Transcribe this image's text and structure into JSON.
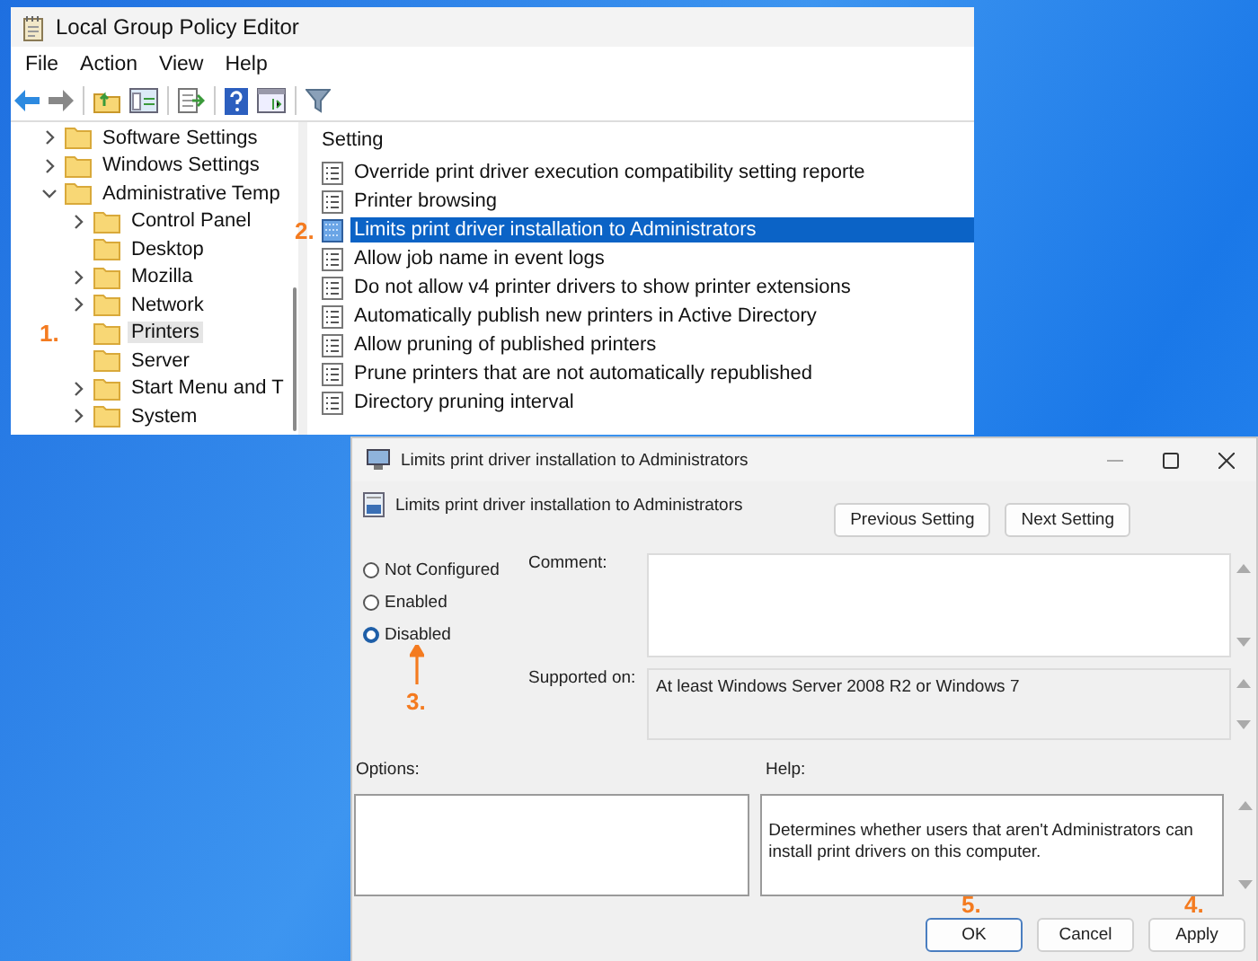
{
  "editor": {
    "title": "Local Group Policy Editor",
    "menu": [
      "File",
      "Action",
      "View",
      "Help"
    ],
    "tree": [
      {
        "label": "Software Settings",
        "expanded": false,
        "selected": false
      },
      {
        "label": "Windows Settings",
        "expanded": false,
        "selected": false
      },
      {
        "label": "Administrative Temp",
        "expanded": true,
        "selected": false,
        "children": [
          {
            "label": "Control Panel",
            "expanded": false,
            "selected": false
          },
          {
            "label": "Desktop",
            "selected": false
          },
          {
            "label": "Mozilla",
            "expanded": false,
            "selected": false
          },
          {
            "label": "Network",
            "expanded": false,
            "selected": false
          },
          {
            "label": "Printers",
            "selected": true,
            "annotation": "1."
          },
          {
            "label": "Server",
            "selected": false
          },
          {
            "label": "Start Menu and T",
            "expanded": false,
            "selected": false
          },
          {
            "label": "System",
            "expanded": false,
            "selected": false
          }
        ]
      }
    ],
    "list": {
      "column": "Setting",
      "rows": [
        {
          "label": "Override print driver execution compatibility setting reporte",
          "selected": false
        },
        {
          "label": "Printer browsing",
          "selected": false
        },
        {
          "label": "Limits print driver installation to Administrators",
          "selected": true,
          "annotation": "2."
        },
        {
          "label": "Allow job name in event logs",
          "selected": false
        },
        {
          "label": "Do not allow v4 printer drivers to show printer extensions",
          "selected": false
        },
        {
          "label": "Automatically publish new printers in Active Directory",
          "selected": false
        },
        {
          "label": "Allow pruning of published printers",
          "selected": false
        },
        {
          "label": "Prune printers that are not automatically republished",
          "selected": false
        },
        {
          "label": "Directory pruning interval",
          "selected": false
        }
      ]
    }
  },
  "dialog": {
    "title": "Limits print driver installation to Administrators",
    "heading": "Limits print driver installation to Administrators",
    "nav_buttons": [
      "Previous Setting",
      "Next Setting"
    ],
    "states": [
      {
        "label": "Not Configured",
        "selected": false
      },
      {
        "label": "Enabled",
        "selected": false
      },
      {
        "label": "Disabled",
        "selected": true,
        "annotation": "3."
      }
    ],
    "comment_label": "Comment:",
    "supported_label": "Supported on:",
    "supported_value": "At least Windows Server 2008 R2 or Windows 7",
    "options_label": "Options:",
    "help_label": "Help:",
    "help_text": "Determines whether users that aren't Administrators can install print drivers on this computer.",
    "buttons": [
      {
        "label": "OK",
        "annotation": "5."
      },
      {
        "label": "Cancel"
      },
      {
        "label": "Apply",
        "annotation": "4."
      }
    ]
  }
}
